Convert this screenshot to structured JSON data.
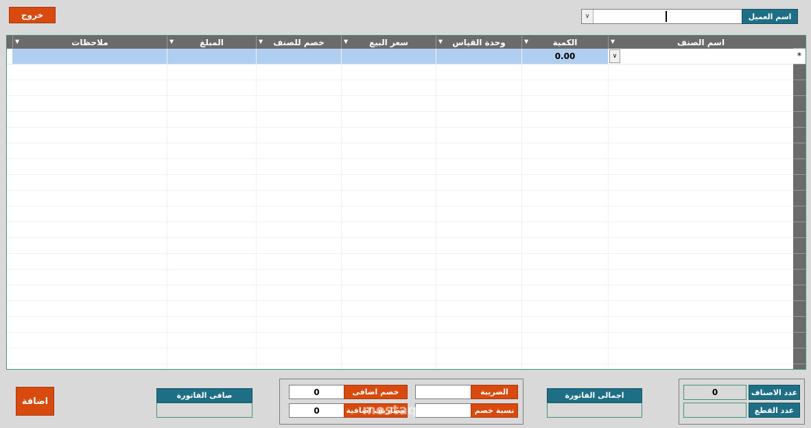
{
  "header": {
    "exit_label": "خروج",
    "customer_label": "اسم العميل",
    "customer_value": ""
  },
  "grid": {
    "columns": [
      "ملاحظات",
      "المبلغ",
      "خصم للصنف",
      "سعر البيع",
      "وحدة القياس",
      "الكمية",
      "اسم الصنف"
    ],
    "new_row": {
      "quantity": "0.00",
      "row_marker": "*"
    },
    "colors": {
      "header": "#6b6b6b",
      "selected_row": "#b0cff0"
    }
  },
  "footer": {
    "add_label": "اضافة",
    "net_invoice_label": "صافى الفاتورة",
    "net_invoice_value": "",
    "tax_label": "الضريبة",
    "tax_value": "",
    "extra_discount_label": "خصم اضافى",
    "extra_discount_value": "0",
    "discount_rate_label": "نسبة خصم",
    "discount_rate_value": "",
    "extra_expenses_label": "مصاريف اضافية",
    "extra_expenses_value": "0",
    "total_invoice_label": "اجمالى الفاتورة",
    "total_invoice_value": "",
    "items_count_label": "عدد الاصناف",
    "items_count_value": "0",
    "pieces_count_label": "عدد القطع",
    "pieces_count_value": ""
  },
  "watermark": "mostaql.com"
}
